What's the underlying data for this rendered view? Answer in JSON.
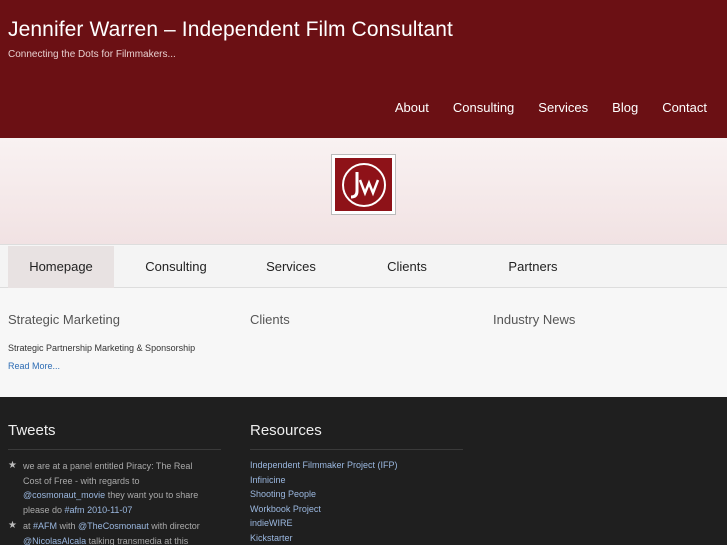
{
  "site": {
    "title": "Jennifer Warren – Independent Film Consultant",
    "tagline": "Connecting the Dots for Filmmakers..."
  },
  "nav": {
    "items": [
      "About",
      "Consulting",
      "Services",
      "Blog",
      "Contact"
    ]
  },
  "logo": {
    "text": "JW"
  },
  "tabs": {
    "items": [
      "Homepage",
      "Consulting",
      "Services",
      "Clients",
      "Partners"
    ],
    "active": "Homepage"
  },
  "columns": {
    "strategic": {
      "title": "Strategic Marketing",
      "text": "Strategic Partnership Marketing & Sponsorship",
      "link": "Read More..."
    },
    "clients": {
      "title": "Clients"
    },
    "news": {
      "title": "Industry News"
    }
  },
  "footer": {
    "tweets_title": "Tweets",
    "resources_title": "Resources",
    "tweets": [
      {
        "l1": "we are at a panel entitled Piracy: The Real",
        "l2": "Cost of Free - with regards to",
        "mention": "@cosmonaut_movie",
        "l3": " they want you to share",
        "l4a": "please do ",
        "hashtag": "#afm",
        "date": " 2010-11-07"
      },
      {
        "a": "at ",
        "hashtag": "#AFM",
        "b": " with ",
        "mention": "@TheCosmonaut",
        "c": " with director",
        "mention2": "@NicolasAlcala",
        "d": " talking transmedia at this"
      }
    ],
    "resources": [
      "Independent Filmmaker Project (IFP)",
      "Infinicine",
      "Shooting People",
      "Workbook Project",
      "indieWIRE",
      "Kickstarter"
    ]
  },
  "colors": {
    "header_bg": "#6b1014",
    "logo_bg": "#8e1218",
    "footer_bg": "#1f1f1f",
    "link": "#2d6cb4",
    "footer_link": "#9bb8e0"
  }
}
